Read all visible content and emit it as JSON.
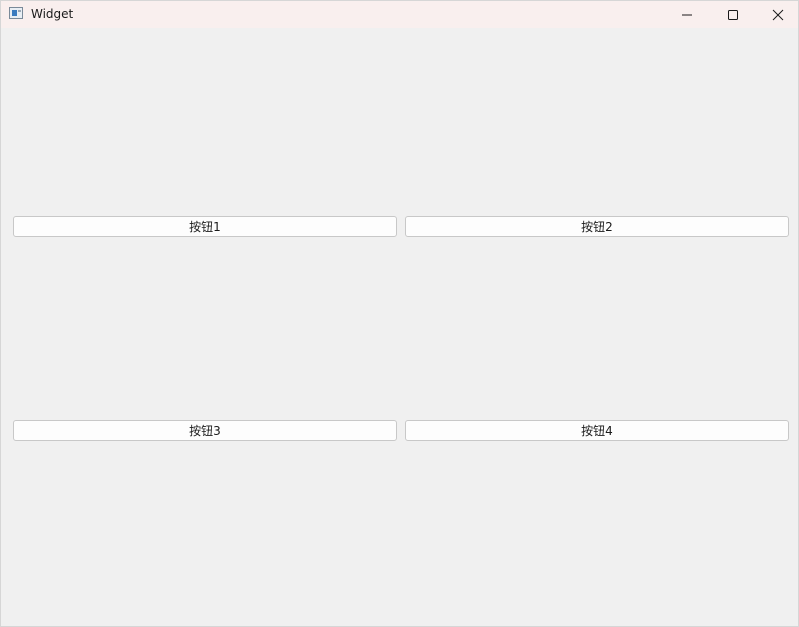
{
  "window": {
    "title": "Widget",
    "app_icon": "app-window-icon",
    "controls": {
      "minimize_icon": "minimize-icon",
      "maximize_icon": "maximize-icon",
      "close_icon": "close-icon"
    }
  },
  "buttons": [
    {
      "label": "按钮1"
    },
    {
      "label": "按钮2"
    },
    {
      "label": "按钮3"
    },
    {
      "label": "按钮4"
    }
  ],
  "colors": {
    "titlebar": "#f9efee",
    "client_background": "#f0f0f0",
    "button_background": "#fdfdfd",
    "button_border": "#c8c8c8"
  }
}
